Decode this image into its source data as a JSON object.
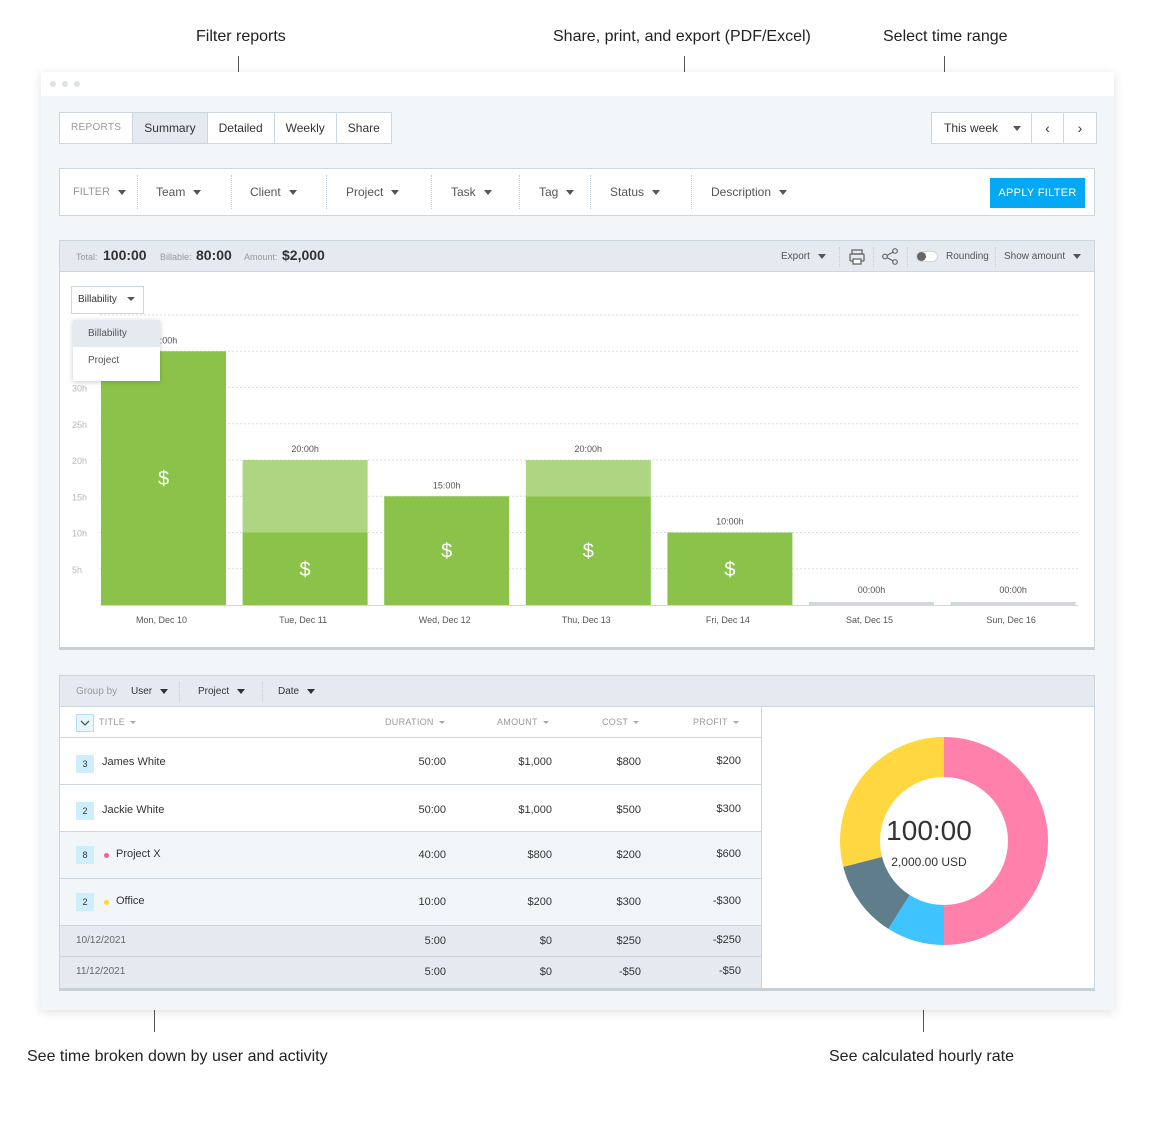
{
  "callouts": {
    "filter": "Filter reports",
    "export": "Share, print, and export (PDF/Excel)",
    "range": "Select time range",
    "breakdown": "See time broken down by user and activity",
    "hourly": "See calculated hourly rate"
  },
  "tabs": {
    "label": "REPORTS",
    "items": [
      "Summary",
      "Detailed",
      "Weekly",
      "Share"
    ],
    "active": "Summary"
  },
  "range": {
    "selected": "This week",
    "prev": "‹",
    "next": "›"
  },
  "filter": {
    "label": "FILTER",
    "items": [
      "Team",
      "Client",
      "Project",
      "Task",
      "Tag",
      "Status",
      "Description"
    ],
    "apply": "APPLY FILTER"
  },
  "summary": {
    "total_label": "Total:",
    "total": "100:00",
    "billable_label": "Billable:",
    "billable": "80:00",
    "amount_label": "Amount:",
    "amount": "$2,000",
    "export": "Export",
    "rounding": "Rounding",
    "show_amount": "Show amount"
  },
  "chart_dropdown": {
    "selected": "Billability",
    "options": [
      "Billability",
      "Project"
    ]
  },
  "colors": {
    "billable": "#8bc34a",
    "nonbillable": "#aed581",
    "empty": "#cfd8dc",
    "accent": "#03a9f4"
  },
  "chart_data": {
    "type": "bar",
    "stacked": true,
    "categories": [
      "Mon, Dec 10",
      "Tue, Dec 11",
      "Wed, Dec 12",
      "Thu, Dec 13",
      "Fri, Dec 14",
      "Sat, Dec 15",
      "Sun, Dec 16"
    ],
    "series": [
      {
        "values": [
          35,
          10,
          15,
          15,
          10,
          0,
          0
        ]
      },
      {
        "values": [
          0,
          10,
          0,
          5,
          0,
          0,
          0
        ]
      }
    ],
    "bar_labels": [
      "35:00h",
      "20:00h",
      "15:00h",
      "20:00h",
      "10:00h",
      "00:00h",
      "00:00h"
    ],
    "y_ticks": [
      {
        "value": 5,
        "label": "5h"
      },
      {
        "value": 10,
        "label": "10h"
      },
      {
        "value": 15,
        "label": "15h"
      },
      {
        "value": 20,
        "label": "20h"
      },
      {
        "value": 25,
        "label": "25h"
      },
      {
        "value": 30,
        "label": "30h"
      }
    ],
    "ylim": [
      0,
      40
    ],
    "billable_marker": "$",
    "grid": true
  },
  "groupby": {
    "label": "Group by",
    "items": [
      "User",
      "Project",
      "Date"
    ]
  },
  "table": {
    "columns": [
      "TITLE",
      "DURATION",
      "AMOUNT",
      "COST",
      "PROFIT"
    ],
    "rows": [
      {
        "kind": "user",
        "badge": "3",
        "title": "James White",
        "duration": "50:00",
        "amount": "$1,000",
        "cost": "$800",
        "profit": "$200"
      },
      {
        "kind": "user",
        "badge": "2",
        "title": "Jackie White",
        "duration": "50:00",
        "amount": "$1,000",
        "cost": "$500",
        "profit": "$300"
      },
      {
        "kind": "project",
        "badge": "8",
        "color": "#f06292",
        "title": "Project X",
        "duration": "40:00",
        "amount": "$800",
        "cost": "$200",
        "profit": "$600"
      },
      {
        "kind": "project",
        "badge": "2",
        "color": "#fdd835",
        "title": "Office",
        "duration": "10:00",
        "amount": "$200",
        "cost": "$300",
        "profit": "-$300"
      },
      {
        "kind": "date",
        "title": "10/12/2021",
        "duration": "5:00",
        "amount": "$0",
        "cost": "$250",
        "profit": "-$250"
      },
      {
        "kind": "date",
        "title": "11/12/2021",
        "duration": "5:00",
        "amount": "$0",
        "cost": "-$50",
        "profit": "-$50"
      }
    ]
  },
  "donut": {
    "total": "100:00",
    "amount": "2,000.00 USD",
    "segments": [
      {
        "value": 50,
        "color": "#ff80ab"
      },
      {
        "value": 9,
        "color": "#40c4ff"
      },
      {
        "value": 12,
        "color": "#607d8b"
      },
      {
        "value": 29,
        "color": "#ffd740"
      }
    ]
  }
}
